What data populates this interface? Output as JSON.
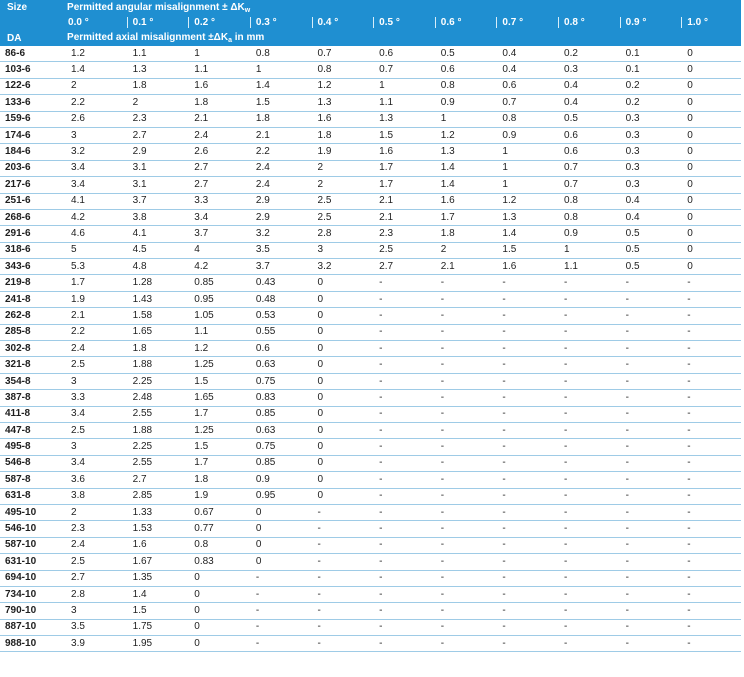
{
  "header": {
    "size_label": "Size",
    "da_label": "DA",
    "angular_title_prefix": "Permitted angular misalignment ± ΔK",
    "angular_title_sub": "w",
    "axial_title_prefix": "Permitted axial misalignment ±ΔK",
    "axial_title_sub": "a",
    "axial_title_suffix": " in mm",
    "angles": [
      "0.0 °",
      "0.1 °",
      "0.2 °",
      "0.3 °",
      "0.4 °",
      "0.5 °",
      "0.6 °",
      "0.7 °",
      "0.8 °",
      "0.9 °",
      "1.0 °"
    ]
  },
  "colors": {
    "header_bg": "#1f8fd1",
    "row_border": "#9ecbe6"
  },
  "rows": [
    {
      "size": "86-6",
      "values": [
        "1.2",
        "1.1",
        "1",
        "0.8",
        "0.7",
        "0.6",
        "0.5",
        "0.4",
        "0.2",
        "0.1",
        "0"
      ]
    },
    {
      "size": "103-6",
      "values": [
        "1.4",
        "1.3",
        "1.1",
        "1",
        "0.8",
        "0.7",
        "0.6",
        "0.4",
        "0.3",
        "0.1",
        "0"
      ]
    },
    {
      "size": "122-6",
      "values": [
        "2",
        "1.8",
        "1.6",
        "1.4",
        "1.2",
        "1",
        "0.8",
        "0.6",
        "0.4",
        "0.2",
        "0"
      ]
    },
    {
      "size": "133-6",
      "values": [
        "2.2",
        "2",
        "1.8",
        "1.5",
        "1.3",
        "1.1",
        "0.9",
        "0.7",
        "0.4",
        "0.2",
        "0"
      ]
    },
    {
      "size": "159-6",
      "values": [
        "2.6",
        "2.3",
        "2.1",
        "1.8",
        "1.6",
        "1.3",
        "1",
        "0.8",
        "0.5",
        "0.3",
        "0"
      ]
    },
    {
      "size": "174-6",
      "values": [
        "3",
        "2.7",
        "2.4",
        "2.1",
        "1.8",
        "1.5",
        "1.2",
        "0.9",
        "0.6",
        "0.3",
        "0"
      ]
    },
    {
      "size": "184-6",
      "values": [
        "3.2",
        "2.9",
        "2.6",
        "2.2",
        "1.9",
        "1.6",
        "1.3",
        "1",
        "0.6",
        "0.3",
        "0"
      ]
    },
    {
      "size": "203-6",
      "values": [
        "3.4",
        "3.1",
        "2.7",
        "2.4",
        "2",
        "1.7",
        "1.4",
        "1",
        "0.7",
        "0.3",
        "0"
      ]
    },
    {
      "size": "217-6",
      "values": [
        "3.4",
        "3.1",
        "2.7",
        "2.4",
        "2",
        "1.7",
        "1.4",
        "1",
        "0.7",
        "0.3",
        "0"
      ]
    },
    {
      "size": "251-6",
      "values": [
        "4.1",
        "3.7",
        "3.3",
        "2.9",
        "2.5",
        "2.1",
        "1.6",
        "1.2",
        "0.8",
        "0.4",
        "0"
      ]
    },
    {
      "size": "268-6",
      "values": [
        "4.2",
        "3.8",
        "3.4",
        "2.9",
        "2.5",
        "2.1",
        "1.7",
        "1.3",
        "0.8",
        "0.4",
        "0"
      ]
    },
    {
      "size": "291-6",
      "values": [
        "4.6",
        "4.1",
        "3.7",
        "3.2",
        "2.8",
        "2.3",
        "1.8",
        "1.4",
        "0.9",
        "0.5",
        "0"
      ]
    },
    {
      "size": "318-6",
      "values": [
        "5",
        "4.5",
        "4",
        "3.5",
        "3",
        "2.5",
        "2",
        "1.5",
        "1",
        "0.5",
        "0"
      ]
    },
    {
      "size": "343-6",
      "values": [
        "5.3",
        "4.8",
        "4.2",
        "3.7",
        "3.2",
        "2.7",
        "2.1",
        "1.6",
        "1.1",
        "0.5",
        "0"
      ]
    },
    {
      "size": "219-8",
      "values": [
        "1.7",
        "1.28",
        "0.85",
        "0.43",
        "0",
        "-",
        "-",
        "-",
        "-",
        "-",
        "-"
      ]
    },
    {
      "size": "241-8",
      "values": [
        "1.9",
        "1.43",
        "0.95",
        "0.48",
        "0",
        "-",
        "-",
        "-",
        "-",
        "-",
        "-"
      ]
    },
    {
      "size": "262-8",
      "values": [
        "2.1",
        "1.58",
        "1.05",
        "0.53",
        "0",
        "-",
        "-",
        "-",
        "-",
        "-",
        "-"
      ]
    },
    {
      "size": "285-8",
      "values": [
        "2.2",
        "1.65",
        "1.1",
        "0.55",
        "0",
        "-",
        "-",
        "-",
        "-",
        "-",
        "-"
      ]
    },
    {
      "size": "302-8",
      "values": [
        "2.4",
        "1.8",
        "1.2",
        "0.6",
        "0",
        "-",
        "-",
        "-",
        "-",
        "-",
        "-"
      ]
    },
    {
      "size": "321-8",
      "values": [
        "2.5",
        "1.88",
        "1.25",
        "0.63",
        "0",
        "-",
        "-",
        "-",
        "-",
        "-",
        "-"
      ]
    },
    {
      "size": "354-8",
      "values": [
        "3",
        "2.25",
        "1.5",
        "0.75",
        "0",
        "-",
        "-",
        "-",
        "-",
        "-",
        "-"
      ]
    },
    {
      "size": "387-8",
      "values": [
        "3.3",
        "2.48",
        "1.65",
        "0.83",
        "0",
        "-",
        "-",
        "-",
        "-",
        "-",
        "-"
      ]
    },
    {
      "size": "411-8",
      "values": [
        "3.4",
        "2.55",
        "1.7",
        "0.85",
        "0",
        "-",
        "-",
        "-",
        "-",
        "-",
        "-"
      ]
    },
    {
      "size": "447-8",
      "values": [
        "2.5",
        "1.88",
        "1.25",
        "0.63",
        "0",
        "-",
        "-",
        "-",
        "-",
        "-",
        "-"
      ]
    },
    {
      "size": "495-8",
      "values": [
        "3",
        "2.25",
        "1.5",
        "0.75",
        "0",
        "-",
        "-",
        "-",
        "-",
        "-",
        "-"
      ]
    },
    {
      "size": "546-8",
      "values": [
        "3.4",
        "2.55",
        "1.7",
        "0.85",
        "0",
        "-",
        "-",
        "-",
        "-",
        "-",
        "-"
      ]
    },
    {
      "size": "587-8",
      "values": [
        "3.6",
        "2.7",
        "1.8",
        "0.9",
        "0",
        "-",
        "-",
        "-",
        "-",
        "-",
        "-"
      ]
    },
    {
      "size": "631-8",
      "values": [
        "3.8",
        "2.85",
        "1.9",
        "0.95",
        "0",
        "-",
        "-",
        "-",
        "-",
        "-",
        "-"
      ]
    },
    {
      "size": "495-10",
      "values": [
        "2",
        "1.33",
        "0.67",
        "0",
        "-",
        "-",
        "-",
        "-",
        "-",
        "-",
        "-"
      ]
    },
    {
      "size": "546-10",
      "values": [
        "2.3",
        "1.53",
        "0.77",
        "0",
        "-",
        "-",
        "-",
        "-",
        "-",
        "-",
        "-"
      ]
    },
    {
      "size": "587-10",
      "values": [
        "2.4",
        "1.6",
        "0.8",
        "0",
        "-",
        "-",
        "-",
        "-",
        "-",
        "-",
        "-"
      ]
    },
    {
      "size": "631-10",
      "values": [
        "2.5",
        "1.67",
        "0.83",
        "0",
        "-",
        "-",
        "-",
        "-",
        "-",
        "-",
        "-"
      ]
    },
    {
      "size": "694-10",
      "values": [
        "2.7",
        "1.35",
        "0",
        "-",
        "-",
        "-",
        "-",
        "-",
        "-",
        "-",
        "-"
      ]
    },
    {
      "size": "734-10",
      "values": [
        "2.8",
        "1.4",
        "0",
        "-",
        "-",
        "-",
        "-",
        "-",
        "-",
        "-",
        "-"
      ]
    },
    {
      "size": "790-10",
      "values": [
        "3",
        "1.5",
        "0",
        "-",
        "-",
        "-",
        "-",
        "-",
        "-",
        "-",
        "-"
      ]
    },
    {
      "size": "887-10",
      "values": [
        "3.5",
        "1.75",
        "0",
        "-",
        "-",
        "-",
        "-",
        "-",
        "-",
        "-",
        "-"
      ]
    },
    {
      "size": "988-10",
      "values": [
        "3.9",
        "1.95",
        "0",
        "-",
        "-",
        "-",
        "-",
        "-",
        "-",
        "-",
        "-"
      ]
    }
  ]
}
